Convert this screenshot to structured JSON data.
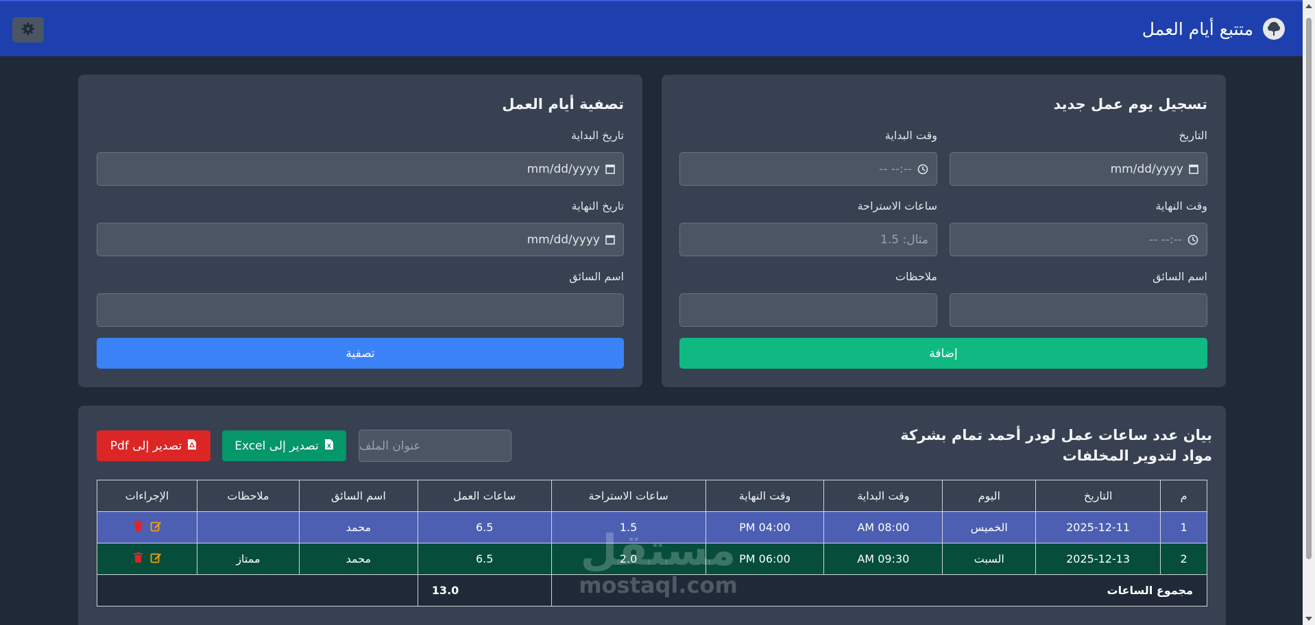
{
  "header": {
    "title": "متتبع أيام العمل"
  },
  "add_form": {
    "title": "تسجيل يوم عمل جديد",
    "date_label": "التاريخ",
    "date_placeholder": "mm/dd/yyyy",
    "start_time_label": "وقت البداية",
    "start_time_placeholder": "--:-- --",
    "end_time_label": "وقت النهاية",
    "end_time_placeholder": "--:-- --",
    "break_label": "ساعات الاستراحة",
    "break_placeholder": "مثال: 1.5",
    "driver_label": "اسم السائق",
    "notes_label": "ملاحظات",
    "submit_label": "إضافة"
  },
  "filter_form": {
    "title": "تصفية أيام العمل",
    "start_date_label": "تاريخ البداية",
    "start_date_placeholder": "mm/dd/yyyy",
    "end_date_label": "تاريخ النهاية",
    "end_date_placeholder": "mm/dd/yyyy",
    "driver_label": "اسم السائق",
    "submit_label": "تصفية"
  },
  "report": {
    "title": "بيان عدد ساعات عمل لودر أحمد تمام بشركة مواد لتدوير المخلفات",
    "file_title_placeholder": "عنوان الملف",
    "export_excel_label": "تصدير إلى Excel",
    "export_pdf_label": "تصدير إلى Pdf",
    "columns": [
      "م",
      "التاريخ",
      "اليوم",
      "وقت البداية",
      "وقت النهاية",
      "ساعات الاستراحة",
      "ساعات العمل",
      "اسم السائق",
      "ملاحظات",
      "الإجراءات"
    ],
    "rows": [
      {
        "num": "1",
        "date": "2025-12-11",
        "day": "الخميس",
        "start": "08:00 AM",
        "end": "04:00 PM",
        "break": "1.5",
        "work": "6.5",
        "driver": "محمد",
        "notes": ""
      },
      {
        "num": "2",
        "date": "2025-12-13",
        "day": "السبت",
        "start": "09:30 AM",
        "end": "06:00 PM",
        "break": "2.0",
        "work": "6.5",
        "driver": "محمد",
        "notes": "ممتاز"
      }
    ],
    "total_label": "مجموع الساعات",
    "total_value": "13.0"
  },
  "watermark": {
    "arabic": "مستقل",
    "latin": "mostaql.com"
  },
  "colors": {
    "header_bg": "#1e40af",
    "add_button": "#10b981",
    "filter_button": "#3b82f6",
    "excel_button": "#059669",
    "pdf_button": "#dc2626",
    "row1_bg": "#4c5fb3",
    "row2_bg": "#064e3b",
    "edit_icon": "#f59e0b",
    "delete_icon": "#dc2626"
  },
  "icons": {
    "settings": "gear-icon",
    "brand": "tree-icon",
    "calendar": "calendar-icon",
    "clock": "clock-icon",
    "excel": "file-excel-icon",
    "pdf": "file-pdf-icon",
    "edit": "edit-icon",
    "delete": "trash-icon"
  }
}
